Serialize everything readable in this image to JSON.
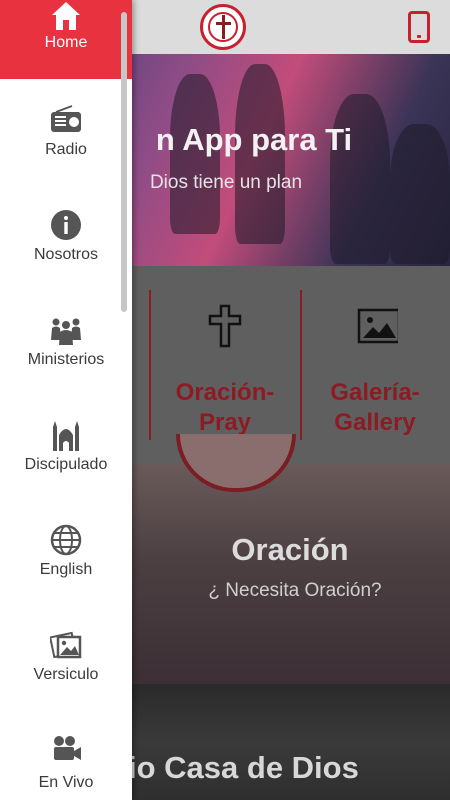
{
  "hero": {
    "title": "n App para Ti",
    "subtitle": "Dios tiene un plan"
  },
  "cards": [
    {
      "label": "Oración-\nPray",
      "icon": "cross-icon"
    },
    {
      "label": "Galería-\nGallery",
      "icon": "picture-icon"
    }
  ],
  "prayer": {
    "title": "Oración",
    "subtitle": "¿ Necesita Oración?"
  },
  "bottom": {
    "title": "io Casa de Dios"
  },
  "drawer": {
    "items": [
      {
        "label": "Home",
        "icon": "home-icon",
        "active": true
      },
      {
        "label": "Radio",
        "icon": "radio-icon"
      },
      {
        "label": "Nosotros",
        "icon": "info-icon"
      },
      {
        "label": "Ministerios",
        "icon": "people-icon"
      },
      {
        "label": "Discipulado",
        "icon": "mosque-icon"
      },
      {
        "label": "English",
        "icon": "globe-icon"
      },
      {
        "label": "Versiculo",
        "icon": "photos-icon"
      },
      {
        "label": "En Vivo",
        "icon": "video-camera-icon"
      }
    ]
  },
  "colors": {
    "accent": "#e8323f",
    "brand_dark_red": "#8d1b24",
    "drawer_bg": "#ffffff"
  }
}
